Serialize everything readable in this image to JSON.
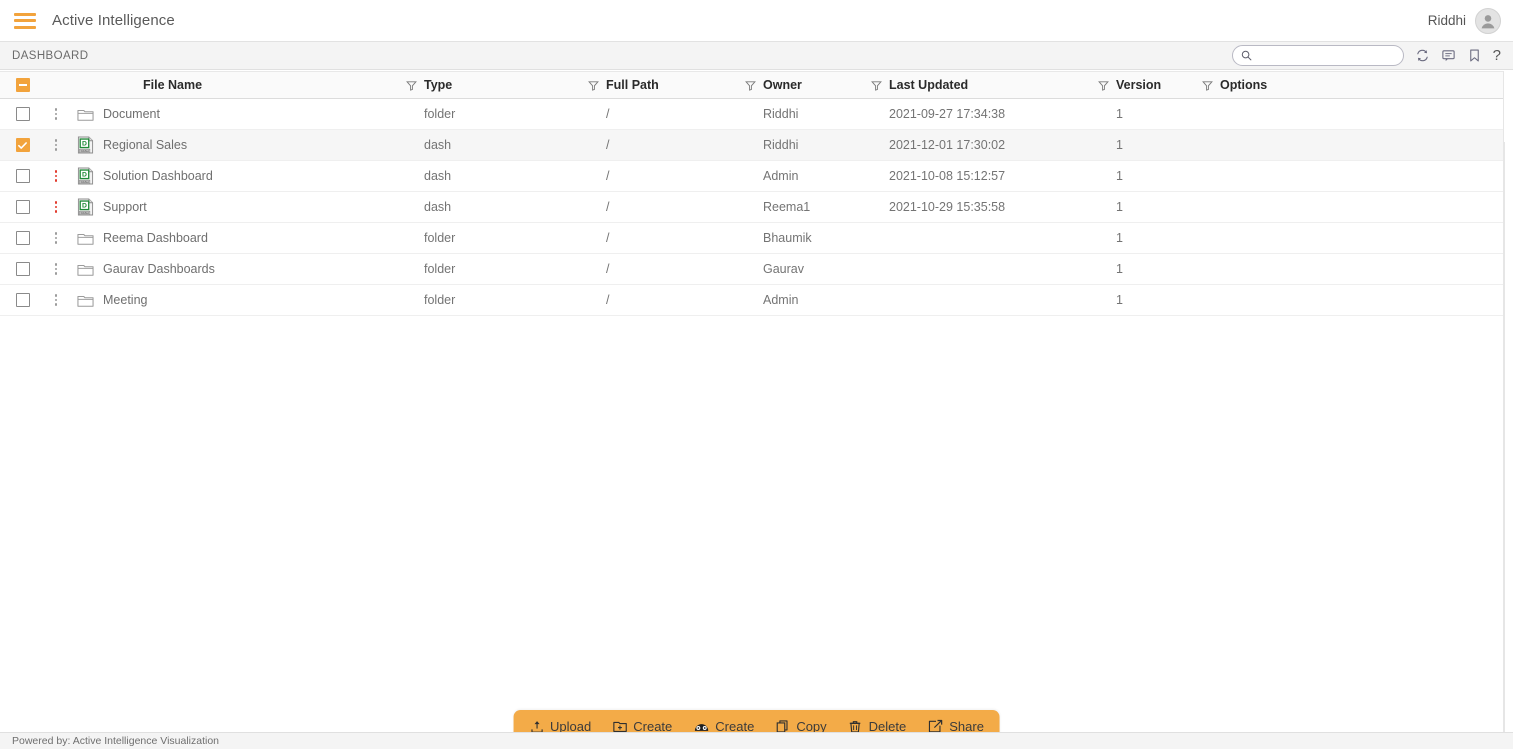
{
  "header": {
    "menu_icon": "hamburger-icon",
    "title": "Active Intelligence",
    "user_name": "Riddhi",
    "avatar_icon": "user-avatar-icon"
  },
  "strip": {
    "breadcrumb": "DASHBOARD",
    "search": {
      "value": "",
      "placeholder": "",
      "icon": "search-icon"
    },
    "icons": [
      {
        "name": "refresh-icon",
        "label": "Refresh"
      },
      {
        "name": "comment-icon",
        "label": "Comments"
      },
      {
        "name": "bookmark-icon",
        "label": "Bookmark"
      },
      {
        "name": "help-icon",
        "label": "?"
      }
    ]
  },
  "table": {
    "select_all_state": "indeterminate",
    "columns": [
      {
        "key": "file_name",
        "label": "File Name",
        "filter": true
      },
      {
        "key": "type",
        "label": "Type",
        "filter": true
      },
      {
        "key": "full_path",
        "label": "Full Path",
        "filter": true
      },
      {
        "key": "owner",
        "label": "Owner",
        "filter": true
      },
      {
        "key": "last_updated",
        "label": "Last Updated",
        "filter": true
      },
      {
        "key": "version",
        "label": "Version",
        "filter": true
      },
      {
        "key": "options",
        "label": "Options",
        "filter": false
      }
    ],
    "rows": [
      {
        "selected": false,
        "kebab": "grey",
        "icon": "folder-icon",
        "file_name": "Document",
        "type": "folder",
        "full_path": "/",
        "owner": "Riddhi",
        "last_updated": "2021-09-27 17:34:38",
        "version": "1",
        "options": ""
      },
      {
        "selected": true,
        "kebab": "grey",
        "icon": "dashboard-file-icon",
        "file_name": "Regional Sales",
        "type": "dash",
        "full_path": "/",
        "owner": "Riddhi",
        "last_updated": "2021-12-01 17:30:02",
        "version": "1",
        "options": ""
      },
      {
        "selected": false,
        "kebab": "red",
        "icon": "dashboard-file-icon",
        "file_name": "Solution Dashboard",
        "type": "dash",
        "full_path": "/",
        "owner": "Admin",
        "last_updated": "2021-10-08 15:12:57",
        "version": "1",
        "options": ""
      },
      {
        "selected": false,
        "kebab": "red",
        "icon": "dashboard-file-icon",
        "file_name": "Support",
        "type": "dash",
        "full_path": "/",
        "owner": "Reema1",
        "last_updated": "2021-10-29 15:35:58",
        "version": "1",
        "options": ""
      },
      {
        "selected": false,
        "kebab": "grey",
        "icon": "folder-icon",
        "file_name": "Reema Dashboard",
        "type": "folder",
        "full_path": "/",
        "owner": "Bhaumik",
        "last_updated": "",
        "version": "1",
        "options": ""
      },
      {
        "selected": false,
        "kebab": "grey",
        "icon": "folder-icon",
        "file_name": "Gaurav Dashboards",
        "type": "folder",
        "full_path": "/",
        "owner": "Gaurav",
        "last_updated": "",
        "version": "1",
        "options": ""
      },
      {
        "selected": false,
        "kebab": "grey",
        "icon": "folder-icon",
        "file_name": "Meeting",
        "type": "folder",
        "full_path": "/",
        "owner": "Admin",
        "last_updated": "",
        "version": "1",
        "options": ""
      }
    ]
  },
  "actionbar": {
    "background": "#f3ab48",
    "buttons": [
      {
        "name": "upload-button",
        "label": "Upload",
        "icon": "upload-icon"
      },
      {
        "name": "create-folder-button",
        "label": "Create",
        "icon": "create-folder-icon"
      },
      {
        "name": "create-dashboard-button",
        "label": "Create",
        "icon": "create-dashboard-icon"
      },
      {
        "name": "copy-button",
        "label": "Copy",
        "icon": "copy-icon"
      },
      {
        "name": "delete-button",
        "label": "Delete",
        "icon": "trash-icon"
      },
      {
        "name": "share-button",
        "label": "Share",
        "icon": "share-icon"
      }
    ]
  },
  "footer": {
    "text": "Powered by: Active Intelligence Visualization"
  },
  "colors": {
    "accent": "#f2a33c",
    "actionbar": "#f3ab48",
    "kebab_alert": "#e23b2e",
    "row_alt": "#f6f6f6"
  }
}
